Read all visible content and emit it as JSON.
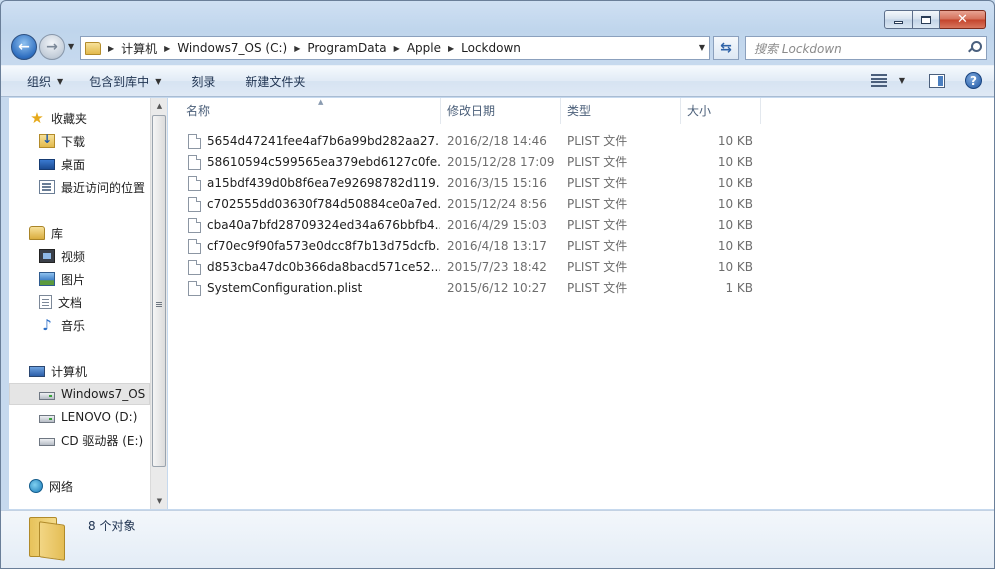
{
  "window": {
    "close_glyph": "✕"
  },
  "address": {
    "crumbs": [
      "计算机",
      "Windows7_OS (C:)",
      "ProgramData",
      "Apple",
      "Lockdown"
    ],
    "search_placeholder": "搜索 Lockdown"
  },
  "toolbar": {
    "organize": "组织",
    "include_library": "包含到库中",
    "burn": "刻录",
    "new_folder": "新建文件夹"
  },
  "nav": {
    "favorites": "收藏夹",
    "downloads": "下载",
    "desktop": "桌面",
    "recent": "最近访问的位置",
    "libraries": "库",
    "videos": "视频",
    "pictures": "图片",
    "documents": "文档",
    "music": "音乐",
    "computer": "计算机",
    "drive_c": "Windows7_OS (C:)",
    "drive_d": "LENOVO (D:)",
    "drive_e": "CD 驱动器 (E:)",
    "network": "网络"
  },
  "columns": {
    "name": "名称",
    "date": "修改日期",
    "type": "类型",
    "size": "大小"
  },
  "files": [
    {
      "name": "5654d47241fee4af7b6a99bd282aa27...",
      "date": "2016/2/18 14:46",
      "type": "PLIST 文件",
      "size": "10 KB"
    },
    {
      "name": "58610594c599565ea379ebd6127c0fe...",
      "date": "2015/12/28 17:09",
      "type": "PLIST 文件",
      "size": "10 KB"
    },
    {
      "name": "a15bdf439d0b8f6ea7e92698782d119...",
      "date": "2016/3/15 15:16",
      "type": "PLIST 文件",
      "size": "10 KB"
    },
    {
      "name": "c702555dd03630f784d50884ce0a7ed...",
      "date": "2015/12/24 8:56",
      "type": "PLIST 文件",
      "size": "10 KB"
    },
    {
      "name": "cba40a7bfd28709324ed34a676bbfb4...",
      "date": "2016/4/29 15:03",
      "type": "PLIST 文件",
      "size": "10 KB"
    },
    {
      "name": "cf70ec9f90fa573e0dcc8f7b13d75dcfb...",
      "date": "2016/4/18 13:17",
      "type": "PLIST 文件",
      "size": "10 KB"
    },
    {
      "name": "d853cba47dc0b366da8bacd571ce52...",
      "date": "2015/7/23 18:42",
      "type": "PLIST 文件",
      "size": "10 KB"
    },
    {
      "name": "SystemConfiguration.plist",
      "date": "2015/6/12 10:27",
      "type": "PLIST 文件",
      "size": "1 KB"
    }
  ],
  "status": {
    "item_count": "8 个对象"
  }
}
